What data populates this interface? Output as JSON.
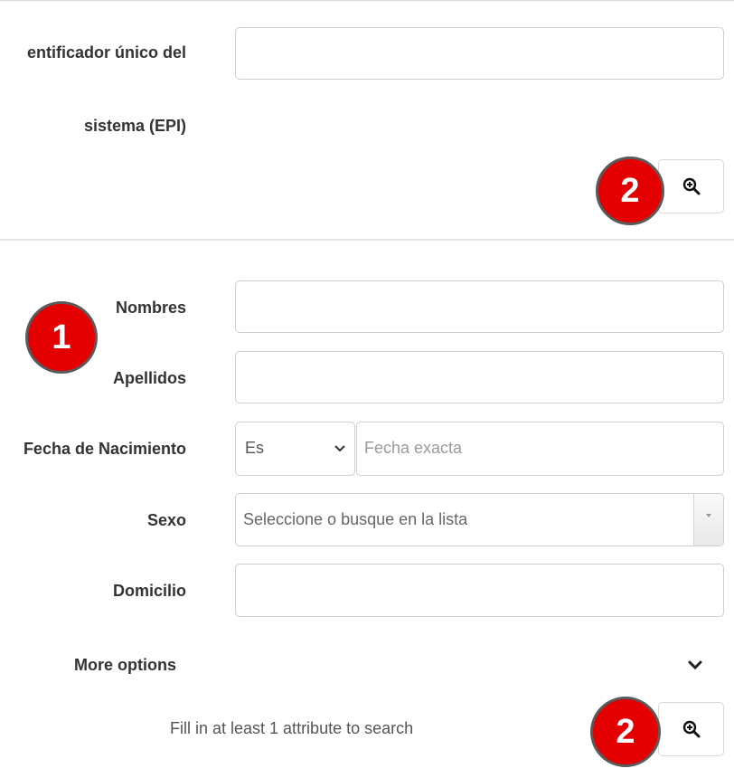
{
  "epi_section": {
    "label_line1": "entificador único del",
    "label_line2": "sistema (EPI)"
  },
  "form": {
    "nombres_label": "Nombres",
    "apellidos_label": "Apellidos",
    "fecha_label": "Fecha de Nacimiento",
    "fecha_operator": "Es",
    "fecha_placeholder": "Fecha exacta",
    "sexo_label": "Sexo",
    "sexo_placeholder": "Seleccione o busque en la lista",
    "domicilio_label": "Domicilio",
    "more_options": "More options",
    "hint": "Fill in at least 1 attribute to search"
  },
  "badges": {
    "one": "1",
    "two": "2"
  },
  "icons": {
    "search": "zoom-in-icon",
    "chevron": "chevron-down-icon",
    "select_arrow": "caret-down-icon"
  }
}
